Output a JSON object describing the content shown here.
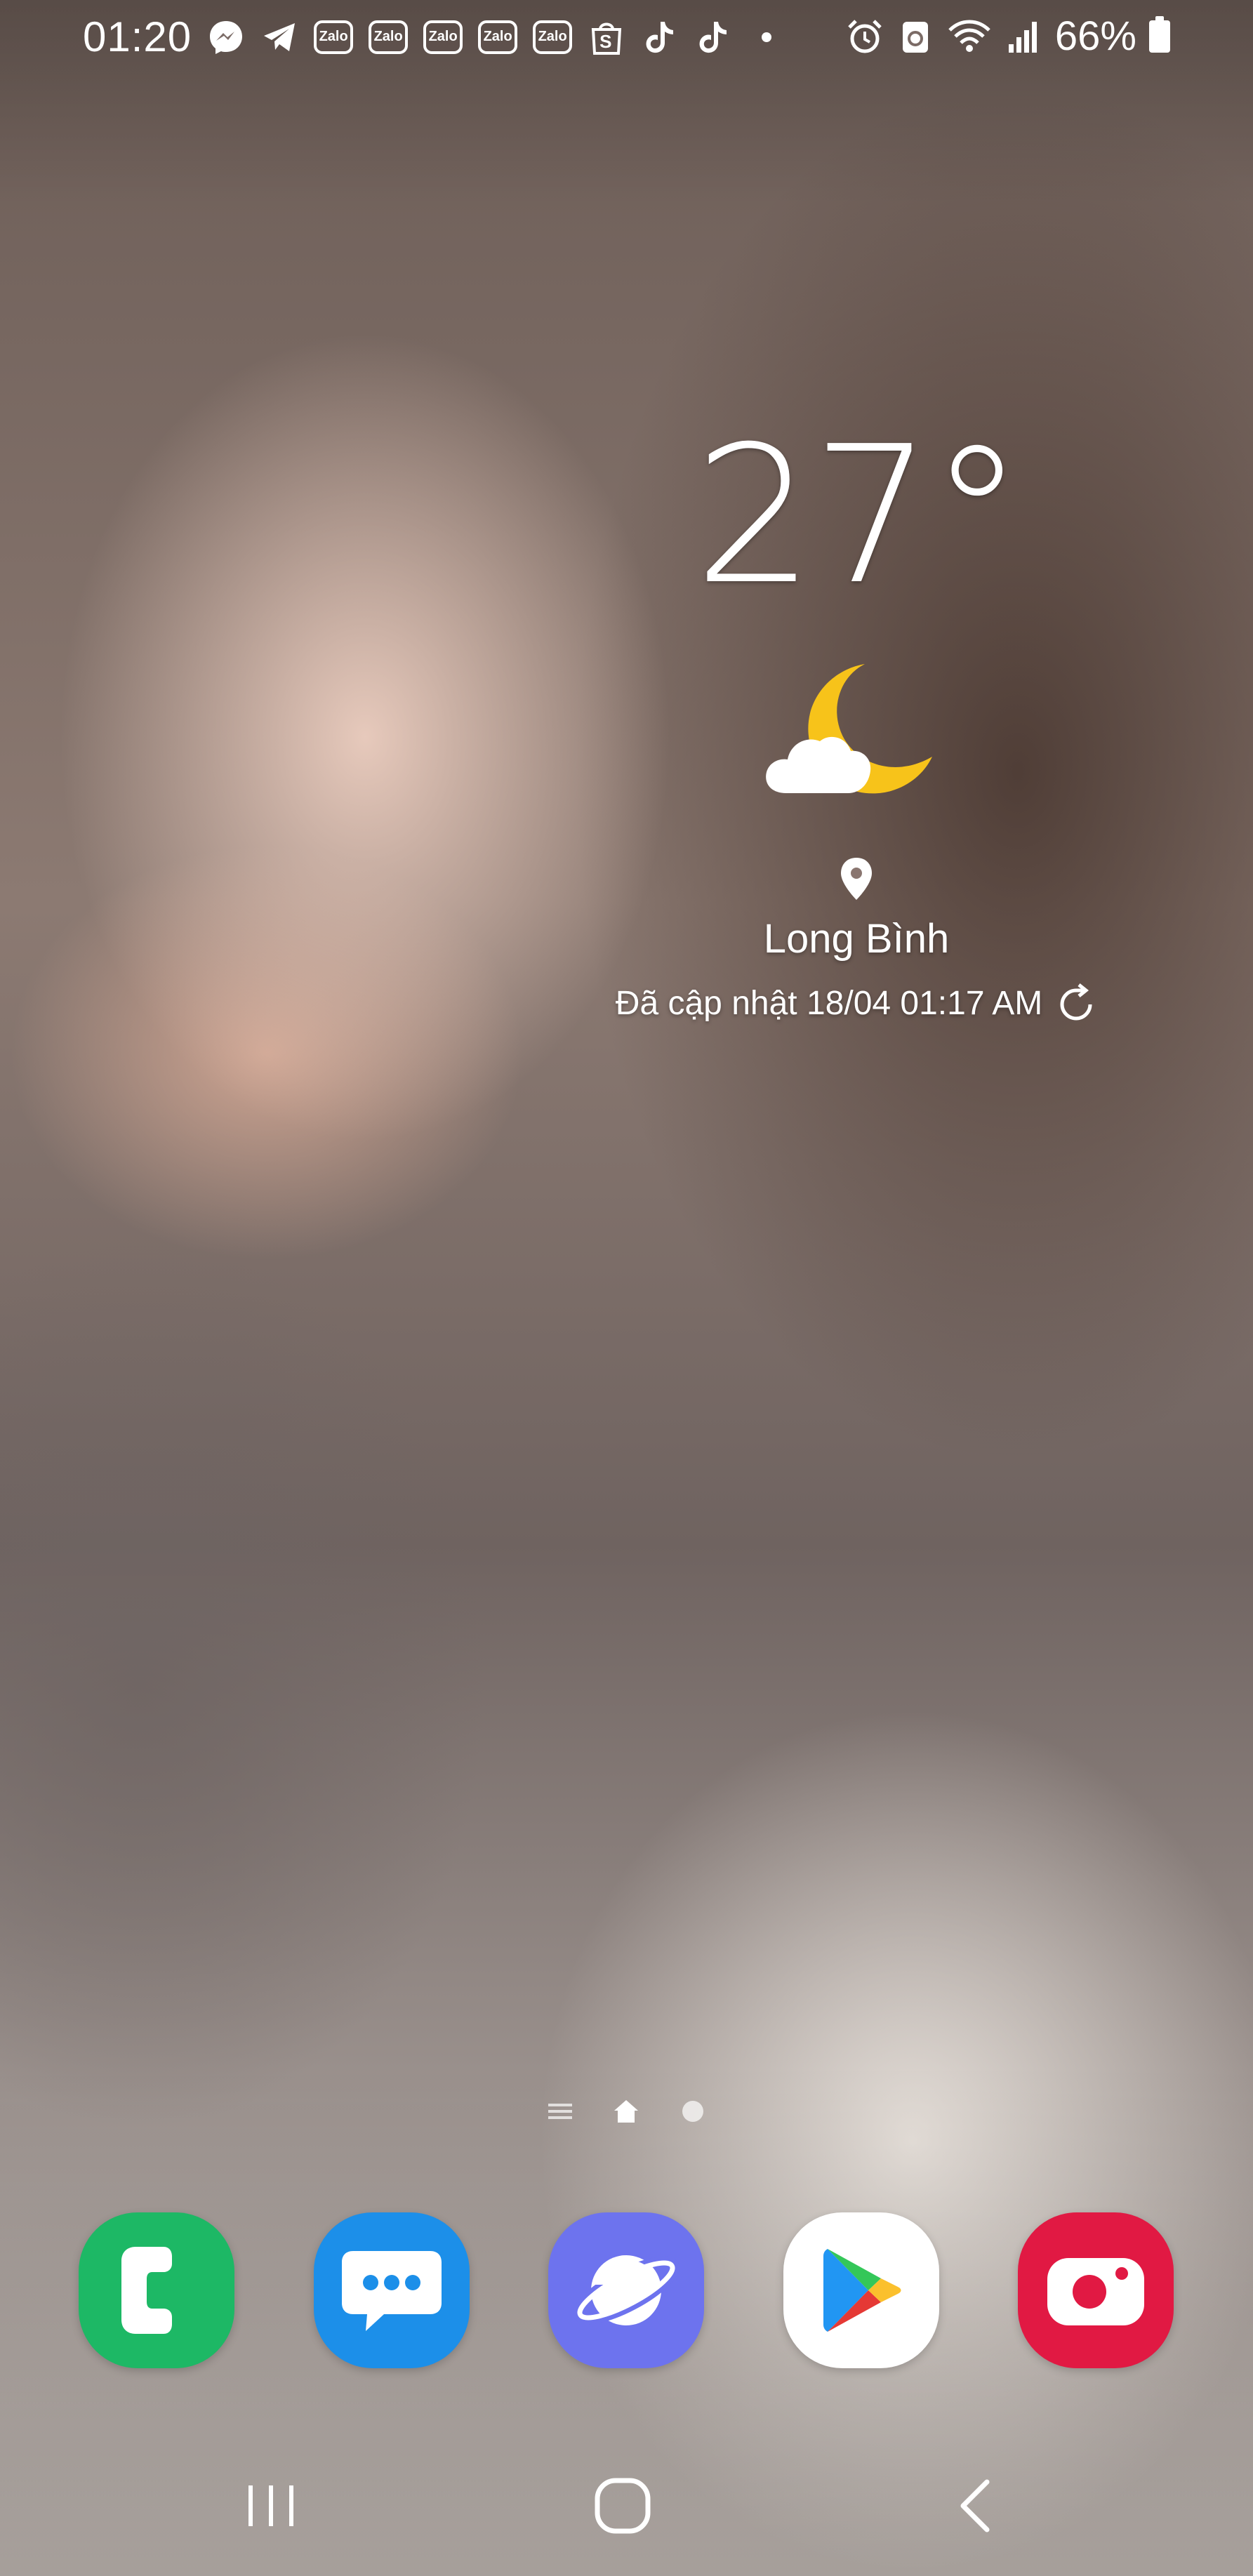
{
  "status_bar": {
    "time": "01:20",
    "notifications": [
      {
        "icon": "messenger-icon"
      },
      {
        "icon": "telegram-icon"
      },
      {
        "icon": "zalo-icon",
        "label": "Zalo"
      },
      {
        "icon": "zalo-icon",
        "label": "Zalo"
      },
      {
        "icon": "zalo-icon",
        "label": "Zalo"
      },
      {
        "icon": "zalo-icon",
        "label": "Zalo"
      },
      {
        "icon": "zalo-icon",
        "label": "Zalo"
      },
      {
        "icon": "shopee-icon",
        "label": "S"
      },
      {
        "icon": "tiktok-icon"
      },
      {
        "icon": "tiktok-icon"
      },
      {
        "icon": "more-dot-icon"
      }
    ],
    "system_icons": [
      "alarm-icon",
      "data-saver-icon",
      "wifi-icon",
      "signal-icon"
    ],
    "battery_percent": "66%",
    "battery_level": 0.66
  },
  "weather": {
    "temperature": "27°",
    "condition_icon": "moon-cloud-icon",
    "location": "Long Bình",
    "updated": "Đã cập nhật 18/04 01:17 AM"
  },
  "page_indicator": {
    "items": [
      "list-icon",
      "home-icon",
      "dot-icon"
    ],
    "active_index": 1
  },
  "dock": {
    "apps": [
      {
        "name": "phone-app",
        "icon": "phone-icon",
        "color": "#1db865"
      },
      {
        "name": "messages-app",
        "icon": "message-bubble-icon",
        "color": "#1c8fe9"
      },
      {
        "name": "internet-app",
        "icon": "planet-icon",
        "color": "#6d73ee"
      },
      {
        "name": "play-store-app",
        "icon": "play-store-icon",
        "color": "#ffffff"
      },
      {
        "name": "camera-app",
        "icon": "camera-icon",
        "color": "#e11943"
      }
    ]
  },
  "nav_bar": {
    "buttons": [
      "recents-icon",
      "home-icon",
      "back-icon"
    ]
  },
  "colors": {
    "moon": "#f7c31a",
    "text": "#ffffff"
  }
}
